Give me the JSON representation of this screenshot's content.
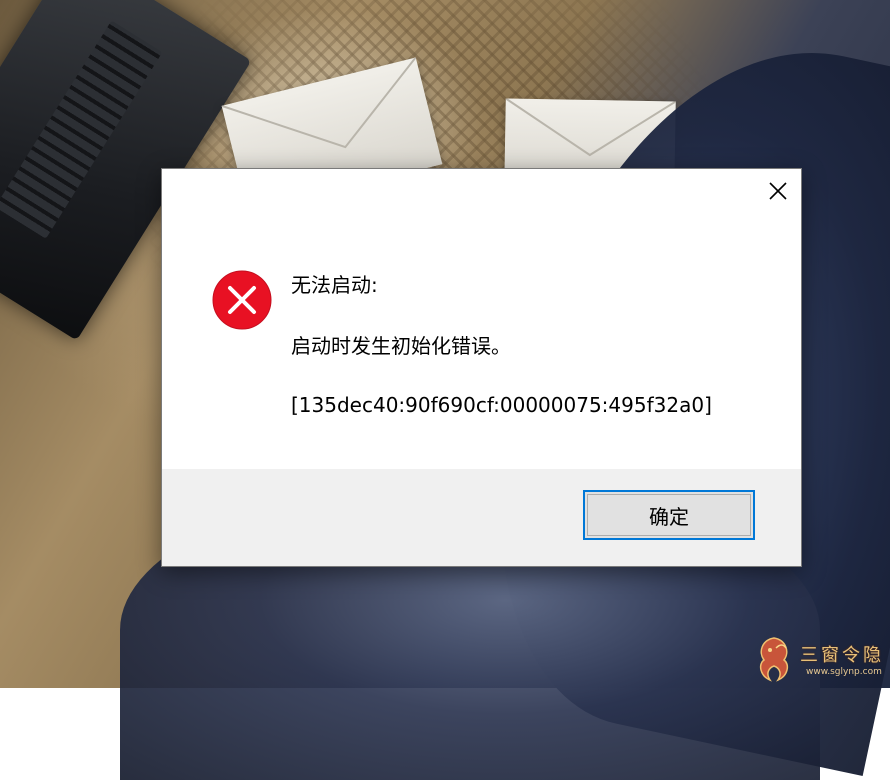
{
  "dialog": {
    "title_line": "无法启动:",
    "message": "启动时发生初始化错误。",
    "error_code": "[135dec40:90f690cf:00000075:495f32a0]",
    "ok_label": "确定",
    "icon": "error-icon",
    "close_icon": "close-icon",
    "accent_color": "#0078d7",
    "error_color": "#e81123"
  },
  "watermark": {
    "title": "三窗令隐",
    "url": "www.sglynp.com"
  }
}
